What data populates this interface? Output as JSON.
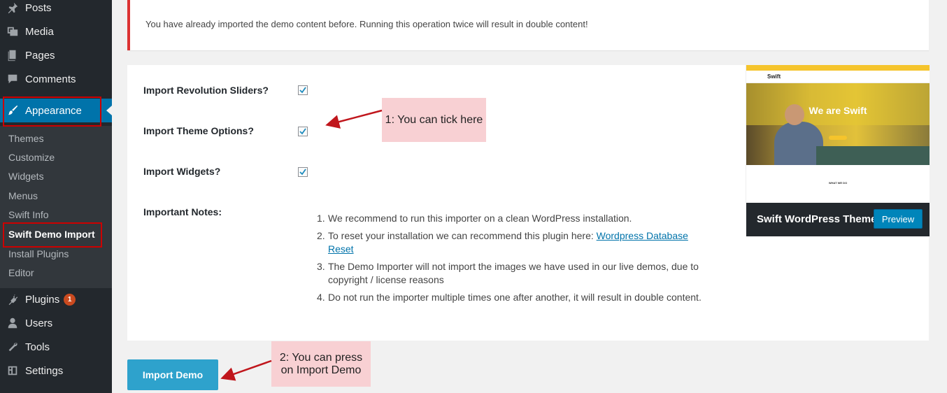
{
  "sidebar": {
    "menu": [
      {
        "label": "Posts",
        "icon": "pin-icon"
      },
      {
        "label": "Media",
        "icon": "media-icon"
      },
      {
        "label": "Pages",
        "icon": "pages-icon"
      },
      {
        "label": "Comments",
        "icon": "comments-icon"
      },
      {
        "label": "Appearance",
        "icon": "brush-icon"
      }
    ],
    "submenu": [
      "Themes",
      "Customize",
      "Widgets",
      "Menus",
      "Swift Info",
      "Swift Demo Import",
      "Install Plugins",
      "Editor"
    ],
    "lower_menu": [
      {
        "label": "Plugins",
        "icon": "plugin-icon",
        "badge": "1"
      },
      {
        "label": "Users",
        "icon": "users-icon"
      },
      {
        "label": "Tools",
        "icon": "wrench-icon"
      },
      {
        "label": "Settings",
        "icon": "settings-icon"
      }
    ]
  },
  "notice": {
    "text": "You have already imported the demo content before. Running this operation twice will result in double content!"
  },
  "options": [
    {
      "label": "Import Revolution Sliders?",
      "checked": true
    },
    {
      "label": "Import Theme Options?",
      "checked": true
    },
    {
      "label": "Import Widgets?",
      "checked": true
    }
  ],
  "notes": {
    "label": "Important Notes:",
    "items": [
      {
        "num": "1.",
        "text": "We recommend to run this importer on a clean WordPress installation."
      },
      {
        "num": "2.",
        "text": "To reset your installation we can recommend this plugin here: ",
        "link": "Wordpress Database Reset"
      },
      {
        "num": "3.",
        "text": "The Demo Importer will not import the images we have used in our live demos, due to copyright / license reasons"
      },
      {
        "num": "4.",
        "text": "Do not run the importer multiple times one after another, it will result in double content."
      }
    ]
  },
  "theme_card": {
    "logo": "Swift",
    "hero_title": "We are Swift",
    "section_heading": "WHAT WE DO",
    "name": "Swift WordPress Theme",
    "preview_label": "Preview"
  },
  "import_button": {
    "label": "Import Demo"
  },
  "annotations": {
    "callout1": "1: You can tick here",
    "callout2_line1": "2: You can press",
    "callout2_line2": "on Import Demo"
  },
  "colors": {
    "sidebar": "#23282d",
    "submenu": "#32373c",
    "accent": "#0073aa",
    "import_button": "#2ea2cc",
    "notice_border": "#dc3232",
    "callout_bg": "#f8d0d3",
    "arrow": "#c0161c"
  }
}
